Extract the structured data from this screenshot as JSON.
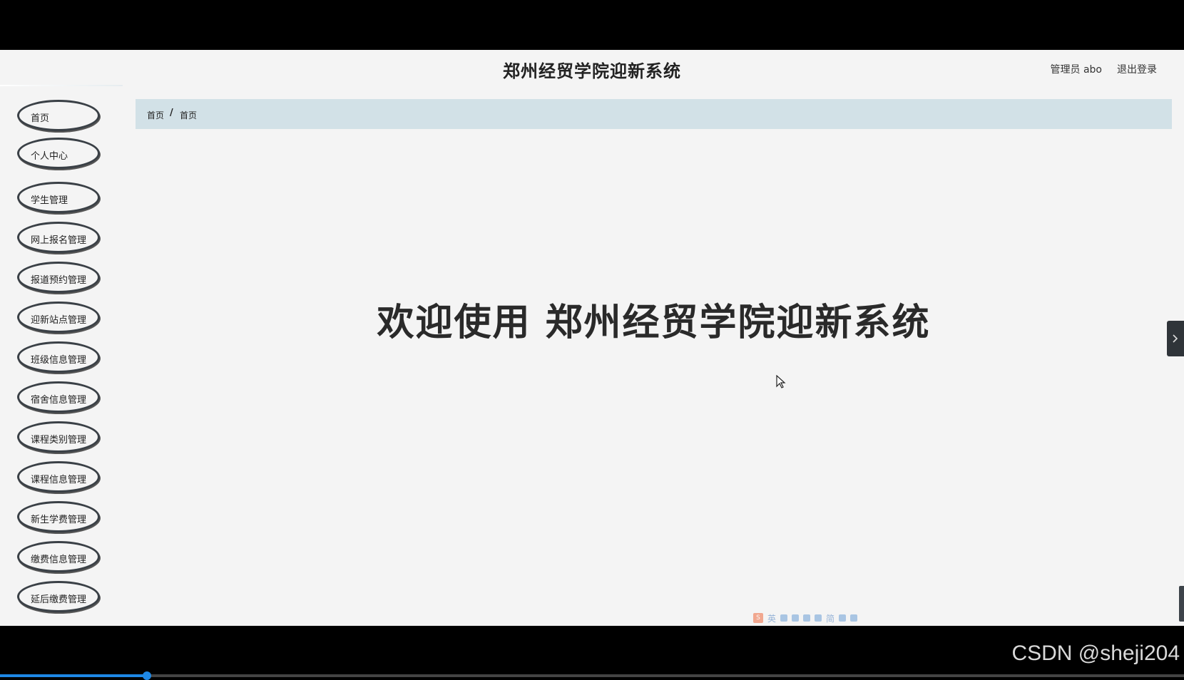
{
  "header": {
    "title": "郑州经贸学院迎新系统",
    "user_label": "管理员 abo",
    "logout_label": "退出登录"
  },
  "sidebar": {
    "items": [
      {
        "label": "首页"
      },
      {
        "label": "个人中心"
      },
      {
        "label": "学生管理"
      },
      {
        "label": "网上报名管理"
      },
      {
        "label": "报道预约管理"
      },
      {
        "label": "迎新站点管理"
      },
      {
        "label": "班级信息管理"
      },
      {
        "label": "宿舍信息管理"
      },
      {
        "label": "课程类别管理"
      },
      {
        "label": "课程信息管理"
      },
      {
        "label": "新生学费管理"
      },
      {
        "label": "缴费信息管理"
      },
      {
        "label": "延后缴费管理"
      }
    ]
  },
  "breadcrumb": {
    "first": "首页",
    "separator": "/",
    "current": "首页"
  },
  "main": {
    "welcome": "欢迎使用 郑州经贸学院迎新系统"
  },
  "ime": {
    "logo": "S",
    "mode": "英",
    "simplified": "简"
  },
  "watermark": "CSDN @sheji204",
  "video": {
    "progress_percent": 12.4
  },
  "colors": {
    "breadcrumb_bg": "#d2e1e7",
    "page_bg": "#f4f4f4",
    "menu_border": "#3a4046",
    "progress": "#1e88e5"
  }
}
